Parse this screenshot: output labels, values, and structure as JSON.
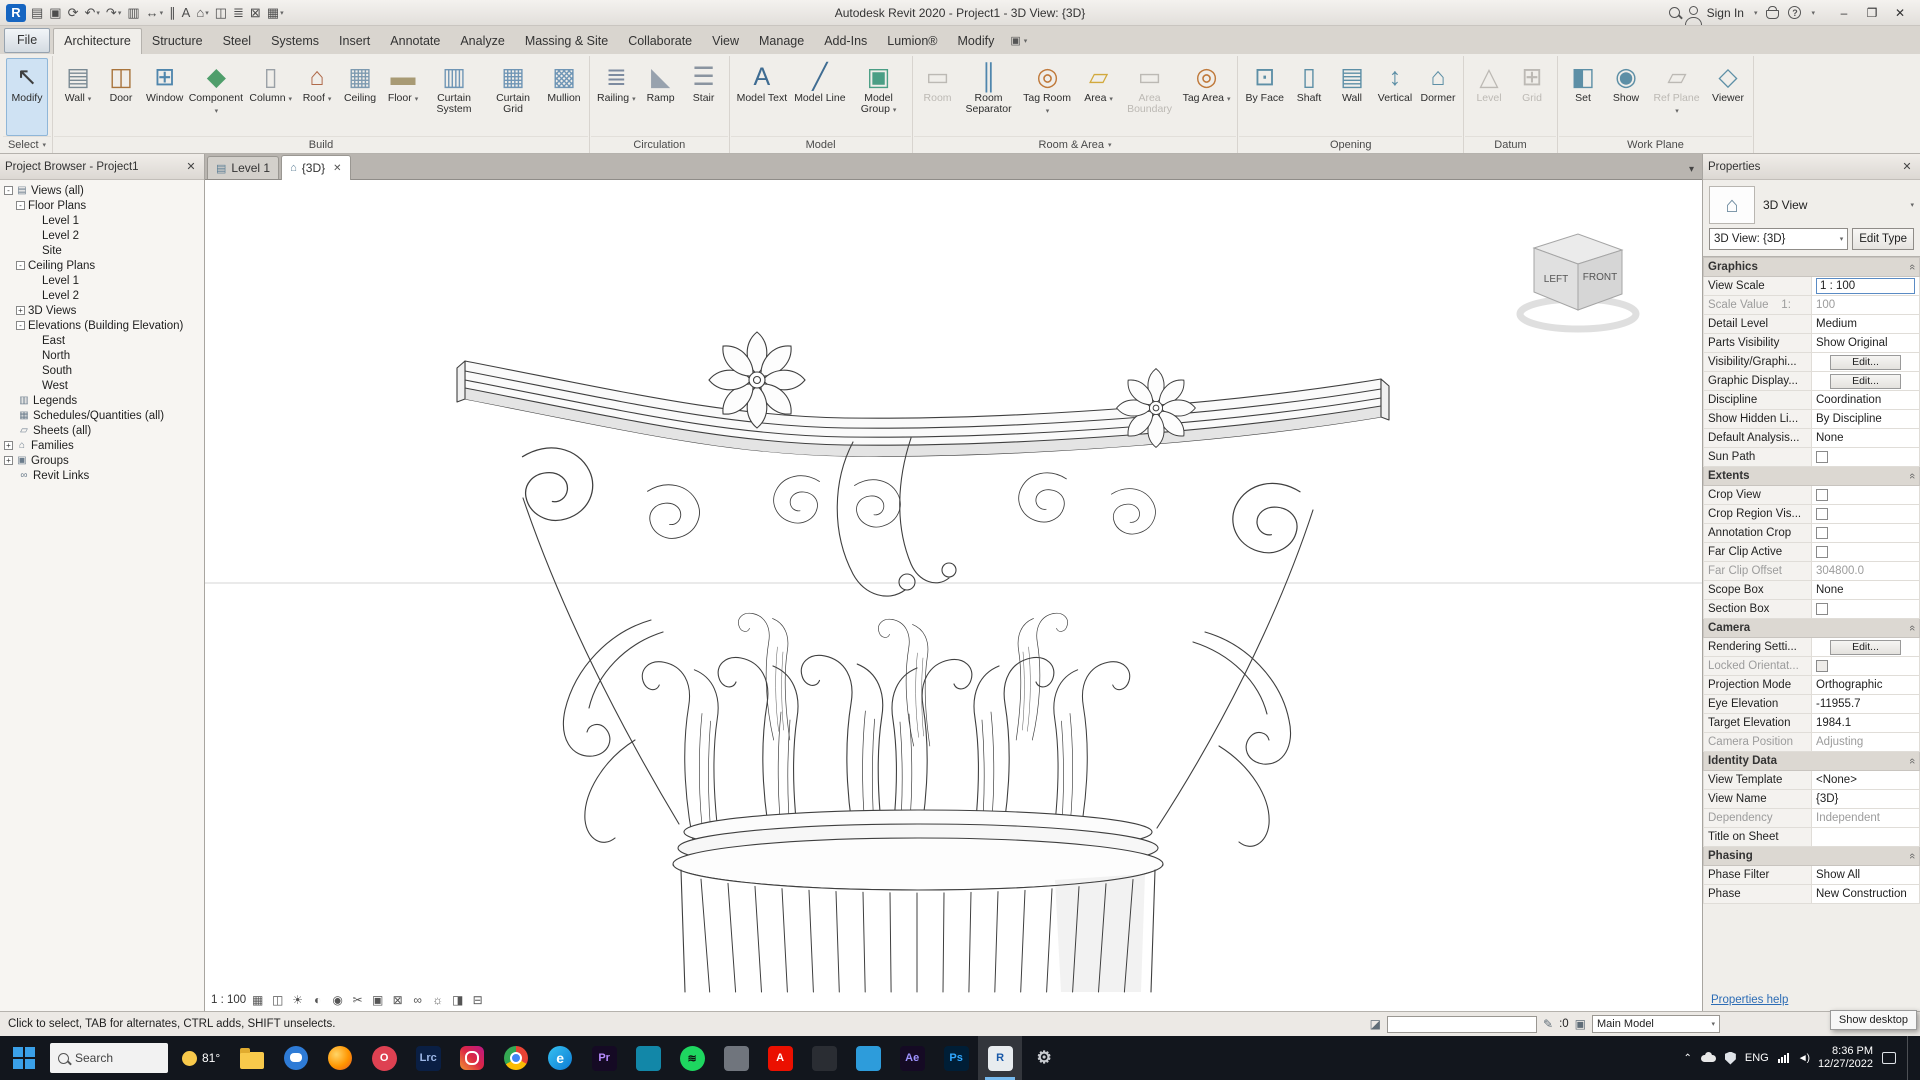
{
  "titlebar": {
    "logo_text": "R",
    "app_title": "Autodesk Revit 2020 - Project1 - 3D View: {3D}",
    "sign_in": "Sign In",
    "quick_access": [
      {
        "name": "open",
        "glyph": "▤"
      },
      {
        "name": "save",
        "glyph": "▣"
      },
      {
        "name": "sync",
        "glyph": "⟳"
      },
      {
        "name": "undo",
        "glyph": "↶",
        "arrow": true
      },
      {
        "name": "redo",
        "glyph": "↷",
        "arrow": true
      },
      {
        "name": "print",
        "glyph": "▥"
      },
      {
        "name": "measure",
        "glyph": "↔",
        "arrow": true
      },
      {
        "name": "aligned-dimension",
        "glyph": "∥"
      },
      {
        "name": "text-note",
        "glyph": "A"
      },
      {
        "name": "default-3d-view",
        "glyph": "⌂",
        "arrow": true
      },
      {
        "name": "section",
        "glyph": "◫"
      },
      {
        "name": "thin-lines",
        "glyph": "≣"
      },
      {
        "name": "close-hidden-windows",
        "glyph": "⊠"
      },
      {
        "name": "switch-windows",
        "glyph": "▦",
        "arrow": true
      }
    ]
  },
  "menubar": {
    "tabs": [
      {
        "label": "File",
        "file": true
      },
      {
        "label": "Architecture",
        "active": true
      },
      {
        "label": "Structure"
      },
      {
        "label": "Steel"
      },
      {
        "label": "Systems"
      },
      {
        "label": "Insert"
      },
      {
        "label": "Annotate"
      },
      {
        "label": "Analyze"
      },
      {
        "label": "Massing & Site"
      },
      {
        "label": "Collaborate"
      },
      {
        "label": "View"
      },
      {
        "label": "Manage"
      },
      {
        "label": "Add-Ins"
      },
      {
        "label": "Lumion®"
      },
      {
        "label": "Modify"
      }
    ]
  },
  "ribbon": {
    "panels": [
      {
        "label": "Select",
        "arrow": true,
        "tools": [
          {
            "label": "Modify",
            "glyph": "↖",
            "color": "#3f3f3f",
            "selected": true
          }
        ]
      },
      {
        "label": "Build",
        "tools": [
          {
            "label": "Wall",
            "glyph": "▤",
            "color": "#7a8a94",
            "arrow": true
          },
          {
            "label": "Door",
            "glyph": "◫",
            "color": "#a9743c"
          },
          {
            "label": "Window",
            "glyph": "⊞",
            "color": "#4f86ad"
          },
          {
            "label": "Component",
            "glyph": "◆",
            "color": "#4f9e6b",
            "arrow": true
          },
          {
            "label": "Column",
            "glyph": "▯",
            "color": "#9aa0a6",
            "arrow": true
          },
          {
            "label": "Roof",
            "glyph": "⌂",
            "color": "#b06a4a",
            "arrow": true
          },
          {
            "label": "Ceiling",
            "glyph": "▦",
            "color": "#7d9ab0"
          },
          {
            "label": "Floor",
            "glyph": "▬",
            "color": "#a89a74",
            "arrow": true
          },
          {
            "label": "Curtain System",
            "glyph": "▥",
            "color": "#6f95b5"
          },
          {
            "label": "Curtain Grid",
            "glyph": "▦",
            "color": "#6f95b5"
          },
          {
            "label": "Mullion",
            "glyph": "▩",
            "color": "#6f95b5"
          }
        ]
      },
      {
        "label": "Circulation",
        "tools": [
          {
            "label": "Railing",
            "glyph": "≣",
            "color": "#7d8ba0",
            "arrow": true
          },
          {
            "label": "Ramp",
            "glyph": "◣",
            "color": "#98a2ae"
          },
          {
            "label": "Stair",
            "glyph": "☰",
            "color": "#8a94a0"
          }
        ]
      },
      {
        "label": "Model",
        "tools": [
          {
            "label": "Model Text",
            "glyph": "A",
            "color": "#3f6c92"
          },
          {
            "label": "Model Line",
            "glyph": "╱",
            "color": "#3f6c92"
          },
          {
            "label": "Model Group",
            "glyph": "▣",
            "color": "#4a9e85",
            "arrow": true
          }
        ]
      },
      {
        "label": "Room & Area",
        "arrow": true,
        "tools": [
          {
            "label": "Room",
            "glyph": "▭",
            "color": "#c9c6c1",
            "disabled": true
          },
          {
            "label": "Room Separator",
            "glyph": "║",
            "color": "#4f86ad"
          },
          {
            "label": "Tag Room",
            "glyph": "◎",
            "color": "#c07a3c",
            "arrow": true
          },
          {
            "label": "Area",
            "glyph": "▱",
            "color": "#d2a93c",
            "arrow": true
          },
          {
            "label": "Area Boundary",
            "glyph": "▭",
            "color": "#c9c6c1",
            "disabled": true
          },
          {
            "label": "Tag Area",
            "glyph": "◎",
            "color": "#c07a3c",
            "arrow": true
          }
        ]
      },
      {
        "label": "Opening",
        "tools": [
          {
            "label": "By Face",
            "glyph": "⊡",
            "color": "#5d8fa6"
          },
          {
            "label": "Shaft",
            "glyph": "▯",
            "color": "#5d8fa6"
          },
          {
            "label": "Wall",
            "glyph": "▤",
            "color": "#5d8fa6"
          },
          {
            "label": "Vertical",
            "glyph": "↕",
            "color": "#5d8fa6"
          },
          {
            "label": "Dormer",
            "glyph": "⌂",
            "color": "#5d8fa6"
          }
        ]
      },
      {
        "label": "Datum",
        "tools": [
          {
            "label": "Level",
            "glyph": "△",
            "color": "#b3b0ab",
            "disabled": true
          },
          {
            "label": "Grid",
            "glyph": "⊞",
            "color": "#b3b0ab",
            "disabled": true
          }
        ]
      },
      {
        "label": "Work Plane",
        "tools": [
          {
            "label": "Set",
            "glyph": "◧",
            "color": "#5d8fa6"
          },
          {
            "label": "Show",
            "glyph": "◉",
            "color": "#5d8fa6"
          },
          {
            "label": "Ref Plane",
            "glyph": "▱",
            "color": "#b3b0ab",
            "disabled": true,
            "arrow": true
          },
          {
            "label": "Viewer",
            "glyph": "◇",
            "color": "#5d8fa6"
          }
        ]
      }
    ]
  },
  "view_tabs": [
    {
      "label": "Level 1",
      "icon": "floor-plan",
      "icon_glyph": "▤"
    },
    {
      "label": "{3D}",
      "icon": "3d-view",
      "icon_glyph": "⌂",
      "active": true
    }
  ],
  "project_browser": {
    "title": "Project Browser - Project1",
    "tree": [
      {
        "label": "Views (all)",
        "icon": "views",
        "exp": "minus",
        "children": [
          {
            "label": "Floor Plans",
            "exp": "minus",
            "children": [
              {
                "label": "Level 1"
              },
              {
                "label": "Level 2"
              },
              {
                "label": "Site"
              }
            ]
          },
          {
            "label": "Ceiling Plans",
            "exp": "minus",
            "children": [
              {
                "label": "Level 1"
              },
              {
                "label": "Level 2"
              }
            ]
          },
          {
            "label": "3D Views",
            "exp": "plus"
          },
          {
            "label": "Elevations (Building Elevation)",
            "exp": "minus",
            "children": [
              {
                "label": "East"
              },
              {
                "label": "North"
              },
              {
                "label": "South"
              },
              {
                "label": "West"
              }
            ]
          }
        ]
      },
      {
        "label": "Legends",
        "icon": "legends"
      },
      {
        "label": "Schedules/Quantities (all)",
        "icon": "schedules"
      },
      {
        "label": "Sheets (all)",
        "icon": "sheets"
      },
      {
        "label": "Families",
        "icon": "families",
        "exp": "plus"
      },
      {
        "label": "Groups",
        "icon": "groups",
        "exp": "plus"
      },
      {
        "label": "Revit Links",
        "icon": "links"
      }
    ]
  },
  "viewport": {
    "viewcube": {
      "left": "LEFT",
      "front": "FRONT"
    }
  },
  "view_controls": {
    "scale": "1 : 100",
    "icons": [
      {
        "name": "detail-level",
        "glyph": "▦"
      },
      {
        "name": "visual-style",
        "glyph": "◫"
      },
      {
        "name": "sun-path",
        "glyph": "☀"
      },
      {
        "name": "shadows",
        "glyph": "◐"
      },
      {
        "name": "rendering-dialog",
        "glyph": "◉"
      },
      {
        "name": "crop-view",
        "glyph": "✂"
      },
      {
        "name": "show-crop-region",
        "glyph": "▣"
      },
      {
        "name": "lock-3d-view",
        "glyph": "⊠"
      },
      {
        "name": "temporary-hide-isolate",
        "glyph": "∞"
      },
      {
        "name": "reveal-hidden-elements",
        "glyph": "☼"
      },
      {
        "name": "temporary-view-properties",
        "glyph": "◨"
      },
      {
        "name": "show-constraints",
        "glyph": "⊟"
      }
    ]
  },
  "properties": {
    "title": "Properties",
    "element_type": "3D View",
    "type_selector": "3D View: {3D}",
    "edit_type_label": "Edit Type",
    "help_label": "Properties help",
    "sections": [
      {
        "title": "Graphics",
        "rows": [
          {
            "label": "View Scale",
            "value": "1 : 100",
            "selected": true
          },
          {
            "label": "Scale Value    1:",
            "value": "100",
            "disabled": true
          },
          {
            "label": "Detail Level",
            "value": "Medium"
          },
          {
            "label": "Parts Visibility",
            "value": "Show Original"
          },
          {
            "label": "Visibility/Graphi...",
            "type": "button",
            "value": "Edit..."
          },
          {
            "label": "Graphic Display...",
            "type": "button",
            "value": "Edit..."
          },
          {
            "label": "Discipline",
            "value": "Coordination"
          },
          {
            "label": "Show Hidden Li...",
            "value": "By Discipline"
          },
          {
            "label": "Default Analysis...",
            "value": "None"
          },
          {
            "label": "Sun Path",
            "type": "checkbox"
          }
        ]
      },
      {
        "title": "Extents",
        "rows": [
          {
            "label": "Crop View",
            "type": "checkbox"
          },
          {
            "label": "Crop Region Vis...",
            "type": "checkbox"
          },
          {
            "label": "Annotation Crop",
            "type": "checkbox"
          },
          {
            "label": "Far Clip Active",
            "type": "checkbox"
          },
          {
            "label": "Far Clip Offset",
            "value": "304800.0",
            "disabled": true
          },
          {
            "label": "Scope Box",
            "value": "None"
          },
          {
            "label": "Section Box",
            "type": "checkbox"
          }
        ]
      },
      {
        "title": "Camera",
        "rows": [
          {
            "label": "Rendering Setti...",
            "type": "button",
            "value": "Edit..."
          },
          {
            "label": "Locked Orientat...",
            "type": "checkbox",
            "disabled": true
          },
          {
            "label": "Projection Mode",
            "value": "Orthographic"
          },
          {
            "label": "Eye Elevation",
            "value": "-11955.7"
          },
          {
            "label": "Target Elevation",
            "value": "1984.1"
          },
          {
            "label": "Camera Position",
            "value": "Adjusting",
            "disabled": true
          }
        ]
      },
      {
        "title": "Identity Data",
        "rows": [
          {
            "label": "View Template",
            "value": "<None>"
          },
          {
            "label": "View Name",
            "value": "{3D}"
          },
          {
            "label": "Dependency",
            "value": "Independent",
            "disabled": true
          },
          {
            "label": "Title on Sheet",
            "value": ""
          }
        ]
      },
      {
        "title": "Phasing",
        "rows": [
          {
            "label": "Phase Filter",
            "value": "Show All"
          },
          {
            "label": "Phase",
            "value": "New Construction"
          }
        ]
      }
    ]
  },
  "statusbar": {
    "hint": "Click to select, TAB for alternates, CTRL adds, SHIFT unselects.",
    "requests_label": ":0",
    "design_option": "Main Model"
  },
  "taskbar": {
    "search_label": "Search",
    "weather_temp": "81°",
    "apps": [
      {
        "name": "file-explorer",
        "skin": "folder"
      },
      {
        "name": "chat",
        "skin": "chat"
      },
      {
        "name": "firefox",
        "skin": "firefox"
      },
      {
        "name": "opera",
        "shape": "circle",
        "bg": "#de4152",
        "fg": "#ffffff",
        "label": "O"
      },
      {
        "name": "lightroom-classic",
        "shape": "square",
        "bg": "#0a1f44",
        "fg": "#9db8e8",
        "label": "Lrc"
      },
      {
        "name": "instagram",
        "skin": "insta"
      },
      {
        "name": "chrome",
        "skin": "chrome"
      },
      {
        "name": "edge",
        "skin": "edge",
        "label": "e"
      },
      {
        "name": "premiere",
        "shape": "square",
        "bg": "#150a24",
        "fg": "#b98eff",
        "label": "Pr"
      },
      {
        "name": "teal-app",
        "shape": "square",
        "bg": "#1287a8",
        "fg": "#ffffff",
        "label": ""
      },
      {
        "name": "spotify",
        "shape": "circle",
        "bg": "#1ed760",
        "fg": "#111111",
        "label": "≋"
      },
      {
        "name": "gray-app",
        "shape": "square",
        "bg": "#70757d",
        "fg": "#ffffff",
        "label": ""
      },
      {
        "name": "adobe",
        "shape": "square",
        "bg": "#eb1000",
        "fg": "#ffffff",
        "label": "A"
      },
      {
        "name": "dark-app",
        "shape": "square",
        "bg": "#2a2d33",
        "fg": "#dddddd",
        "label": ""
      },
      {
        "name": "blue-app",
        "shape": "square",
        "bg": "#2d9cdb",
        "fg": "#ffffff",
        "label": ""
      },
      {
        "name": "after-effects",
        "shape": "square",
        "bg": "#150a24",
        "fg": "#9f93ff",
        "label": "Ae"
      },
      {
        "name": "photoshop",
        "shape": "square",
        "bg": "#001e36",
        "fg": "#31a8ff",
        "label": "Ps"
      },
      {
        "name": "revit",
        "shape": "square",
        "bg": "#e8ecef",
        "fg": "#1858a8",
        "label": "R",
        "active": true
      },
      {
        "name": "settings",
        "skin": "gear",
        "label": "⚙"
      }
    ]
  },
  "tray": {
    "lang": "ENG",
    "time": "8:36 PM",
    "date": "12/27/2022"
  },
  "tooltip": {
    "show_desktop": "Show desktop"
  }
}
